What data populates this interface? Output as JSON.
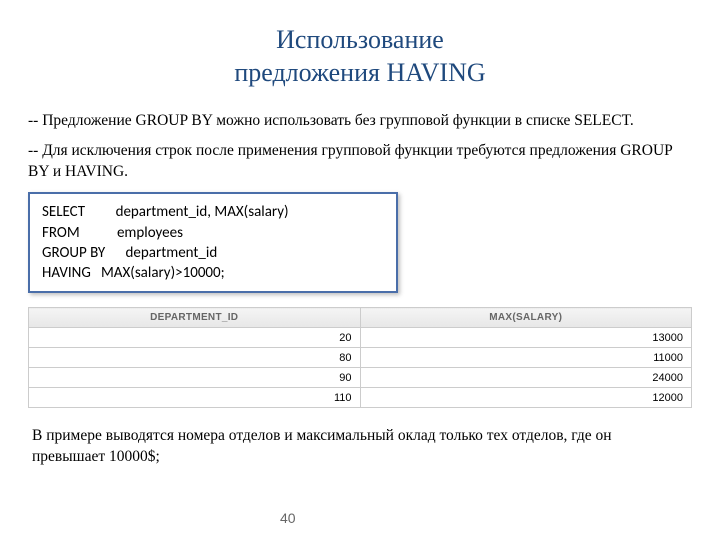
{
  "title_line1": "Использование",
  "title_line2": "предложения HAVING",
  "para1": "-- Предложение GROUP BY можно использовать без групповой функции в списке SELECT.",
  "para2": "-- Для исключения строк после применения групповой функции требуются предложения GROUP BY и HAVING.",
  "sql": {
    "l1": "SELECT         department_id, MAX(salary)",
    "l2": "FROM           employees",
    "l3": "GROUP BY      department_id",
    "l4": "HAVING   MAX(salary)>10000;"
  },
  "table": {
    "h1": "DEPARTMENT_ID",
    "h2": "MAX(SALARY)",
    "rows": [
      {
        "c1": "20",
        "c2": "13000"
      },
      {
        "c1": "80",
        "c2": "11000"
      },
      {
        "c1": "90",
        "c2": "24000"
      },
      {
        "c1": "110",
        "c2": "12000"
      }
    ]
  },
  "caption": "В примере выводятся номера отделов и максимальный оклад только тех отделов, где он превышает 10000$;",
  "pagenum": "40"
}
